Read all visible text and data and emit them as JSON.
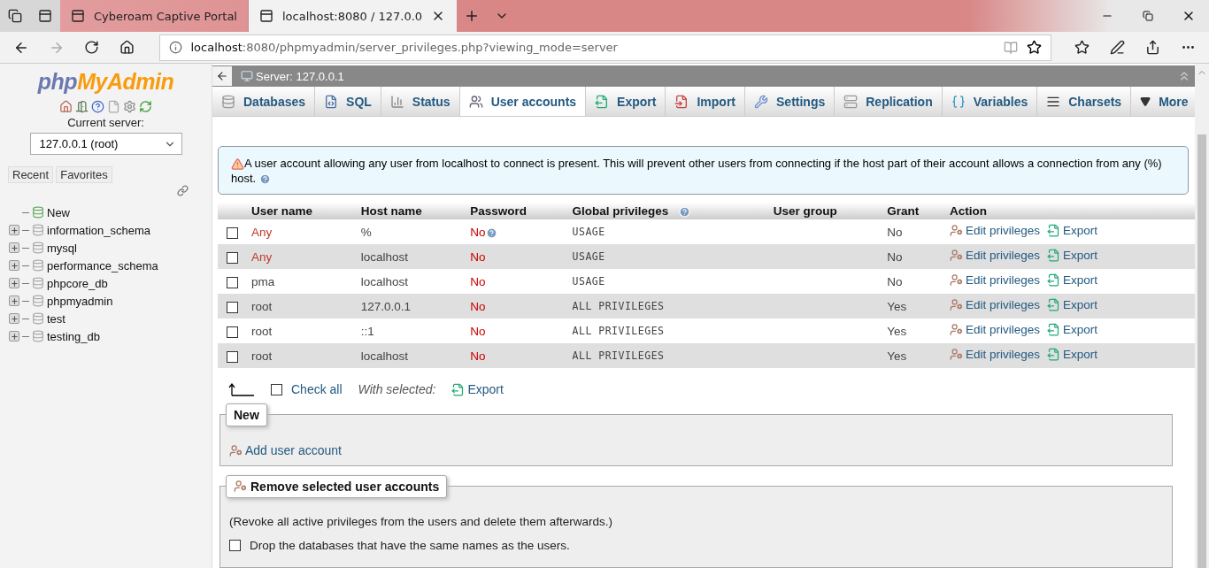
{
  "browser": {
    "tabs": [
      {
        "title": "Cyberoam Captive Portal",
        "selected": false
      },
      {
        "title": "localhost:8080 / 127.0.0",
        "selected": true
      }
    ],
    "address": {
      "host": "localhost",
      "rest": ":8080/phpmyadmin/server_privileges.php?viewing_mode=server"
    }
  },
  "sidebar": {
    "logo_php": "php",
    "logo_rest": "MyAdmin",
    "current_server_label": "Current server:",
    "server_select": "127.0.0.1 (root)",
    "buttons": [
      "Recent",
      "Favorites"
    ],
    "tree": [
      {
        "label": "New",
        "kind": "new"
      },
      {
        "label": "information_schema",
        "kind": "db"
      },
      {
        "label": "mysql",
        "kind": "db"
      },
      {
        "label": "performance_schema",
        "kind": "db"
      },
      {
        "label": "phpcore_db",
        "kind": "db"
      },
      {
        "label": "phpmyadmin",
        "kind": "db"
      },
      {
        "label": "test",
        "kind": "db"
      },
      {
        "label": "testing_db",
        "kind": "db"
      }
    ]
  },
  "server_bar": {
    "title": "Server: 127.0.0.1"
  },
  "tabs": [
    {
      "label": "Databases",
      "selected": false
    },
    {
      "label": "SQL",
      "selected": false
    },
    {
      "label": "Status",
      "selected": false
    },
    {
      "label": "User accounts",
      "selected": true
    },
    {
      "label": "Export",
      "selected": false
    },
    {
      "label": "Import",
      "selected": false
    },
    {
      "label": "Settings",
      "selected": false
    },
    {
      "label": "Replication",
      "selected": false
    },
    {
      "label": "Variables",
      "selected": false
    },
    {
      "label": "Charsets",
      "selected": false
    },
    {
      "label": "More",
      "selected": false
    }
  ],
  "notice": "A user account allowing any user from localhost to connect is present. This will prevent other users from connecting if the host part of their account allows a connection from any (%) host.",
  "table": {
    "columns": [
      "User name",
      "Host name",
      "Password",
      "Global privileges",
      "User group",
      "Grant",
      "Action"
    ],
    "rows": [
      {
        "user": "Any",
        "anonymous": true,
        "host": "%",
        "password": "No",
        "password_help": true,
        "privileges": "USAGE",
        "grant": "No",
        "edit": "Edit privileges",
        "export": "Export",
        "checked": false
      },
      {
        "user": "Any",
        "anonymous": true,
        "host": "localhost",
        "password": "No",
        "password_help": false,
        "privileges": "USAGE",
        "grant": "No",
        "edit": "Edit privileges",
        "export": "Export",
        "checked": false
      },
      {
        "user": "pma",
        "anonymous": false,
        "host": "localhost",
        "password": "No",
        "password_help": false,
        "privileges": "USAGE",
        "grant": "No",
        "edit": "Edit privileges",
        "export": "Export",
        "checked": false
      },
      {
        "user": "root",
        "anonymous": false,
        "host": "127.0.0.1",
        "password": "No",
        "password_help": false,
        "privileges": "ALL PRIVILEGES",
        "grant": "Yes",
        "edit": "Edit privileges",
        "export": "Export",
        "checked": false
      },
      {
        "user": "root",
        "anonymous": false,
        "host": "::1",
        "password": "No",
        "password_help": false,
        "privileges": "ALL PRIVILEGES",
        "grant": "Yes",
        "edit": "Edit privileges",
        "export": "Export",
        "checked": false
      },
      {
        "user": "root",
        "anonymous": false,
        "host": "localhost",
        "password": "No",
        "password_help": false,
        "privileges": "ALL PRIVILEGES",
        "grant": "Yes",
        "edit": "Edit privileges",
        "export": "Export",
        "checked": false
      }
    ]
  },
  "bulk": {
    "check_all": "Check all",
    "checked": false,
    "with_selected": "With selected:",
    "export": "Export"
  },
  "new_section": {
    "legend": "New",
    "link": "Add user account"
  },
  "remove_section": {
    "legend": "Remove selected user accounts",
    "note": "(Revoke all active privileges from the users and delete them afterwards.)",
    "drop_label": "Drop the databases that have the same names as the users.",
    "drop_checked": false
  }
}
